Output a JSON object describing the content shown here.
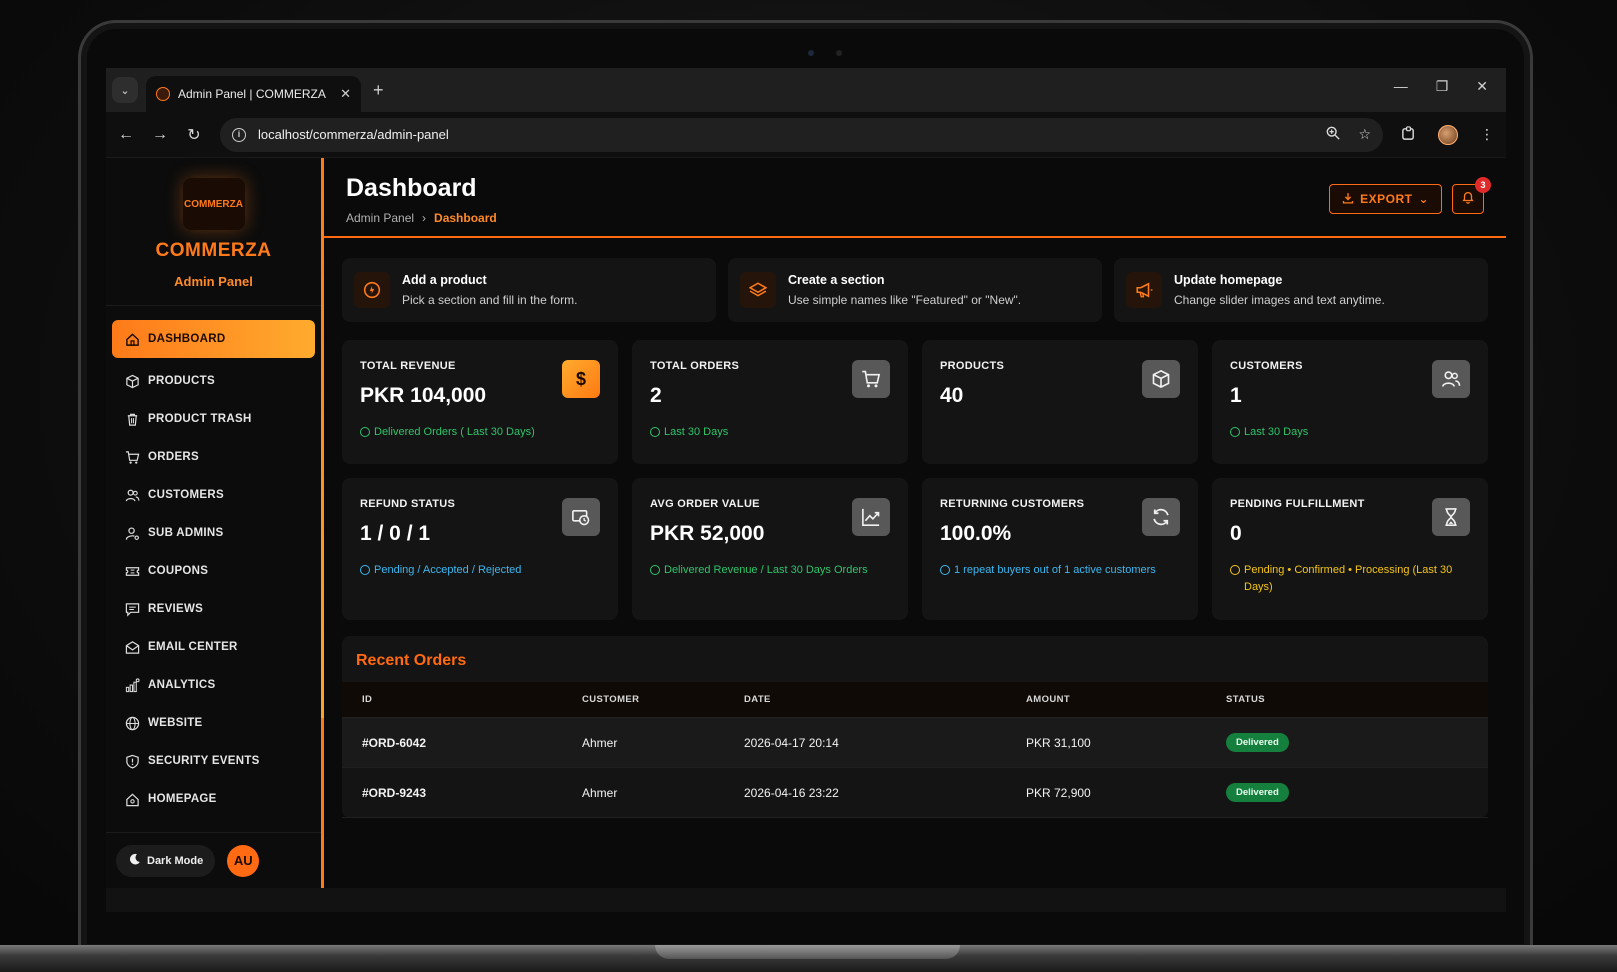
{
  "browser": {
    "tab_title": "Admin Panel | COMMERZA",
    "url": "localhost/commerza/admin-panel"
  },
  "brand": {
    "logo_text": "COMMERZA",
    "name": "COMMERZA",
    "subtitle": "Admin Panel"
  },
  "sidebar": {
    "items": [
      {
        "label": "DASHBOARD",
        "icon": "home-icon"
      },
      {
        "label": "PRODUCTS",
        "icon": "box-icon"
      },
      {
        "label": "PRODUCT TRASH",
        "icon": "trash-icon"
      },
      {
        "label": "ORDERS",
        "icon": "cart-icon"
      },
      {
        "label": "CUSTOMERS",
        "icon": "users-icon"
      },
      {
        "label": "SUB ADMINS",
        "icon": "user-cog-icon"
      },
      {
        "label": "COUPONS",
        "icon": "ticket-icon"
      },
      {
        "label": "REVIEWS",
        "icon": "message-icon"
      },
      {
        "label": "EMAIL CENTER",
        "icon": "mail-icon"
      },
      {
        "label": "ANALYTICS",
        "icon": "chart-icon"
      },
      {
        "label": "WEBSITE",
        "icon": "globe-icon"
      },
      {
        "label": "SECURITY EVENTS",
        "icon": "shield-icon"
      },
      {
        "label": "HOMEPAGE",
        "icon": "house-icon"
      }
    ],
    "dark_mode_label": "Dark Mode",
    "user_initials": "AU"
  },
  "header": {
    "title": "Dashboard",
    "breadcrumb_root": "Admin Panel",
    "breadcrumb_sep": "›",
    "breadcrumb_current": "Dashboard",
    "export_label": "EXPORT",
    "notification_count": "3"
  },
  "quick_actions": [
    {
      "title": "Add a product",
      "desc": "Pick a section and fill in the form."
    },
    {
      "title": "Create a section",
      "desc": "Use simple names like \"Featured\" or \"New\"."
    },
    {
      "title": "Update homepage",
      "desc": "Change slider images and text anytime."
    }
  ],
  "stats": [
    {
      "label": "TOTAL REVENUE",
      "value": "PKR 104,000",
      "note": "Delivered Orders ( Last 30 Days)",
      "note_color": "#2ec46b"
    },
    {
      "label": "TOTAL ORDERS",
      "value": "2",
      "note": "Last 30 Days",
      "note_color": "#2ec46b"
    },
    {
      "label": "PRODUCTS",
      "value": "40",
      "note": ""
    },
    {
      "label": "CUSTOMERS",
      "value": "1",
      "note": "Last 30 Days",
      "note_color": "#2ec46b"
    },
    {
      "label": "REFUND STATUS",
      "value": "1 / 0 / 1",
      "note": "Pending / Accepted / Rejected",
      "note_color": "#3db7f0"
    },
    {
      "label": "AVG ORDER VALUE",
      "value": "PKR 52,000",
      "note": "Delivered Revenue / Last 30 Days Orders",
      "note_color": "#2ec46b"
    },
    {
      "label": "RETURNING CUSTOMERS",
      "value": "100.0%",
      "note": "1 repeat buyers out of 1 active customers",
      "note_color": "#3db7f0"
    },
    {
      "label": "PENDING FULFILLMENT",
      "value": "0",
      "note": "Pending • Confirmed • Processing (Last 30 Days)",
      "note_color": "#f5c518"
    }
  ],
  "orders": {
    "title": "Recent Orders",
    "columns": [
      "ID",
      "CUSTOMER",
      "DATE",
      "AMOUNT",
      "STATUS"
    ],
    "rows": [
      {
        "id": "#ORD-6042",
        "customer": "Ahmer",
        "date": "2026-04-17 20:14",
        "amount": "PKR 31,100",
        "status": "Delivered"
      },
      {
        "id": "#ORD-9243",
        "customer": "Ahmer",
        "date": "2026-04-16 23:22",
        "amount": "PKR 72,900",
        "status": "Delivered"
      }
    ]
  },
  "colors": {
    "accent": "#ff7a1a",
    "status_delivered": "#15803d"
  }
}
